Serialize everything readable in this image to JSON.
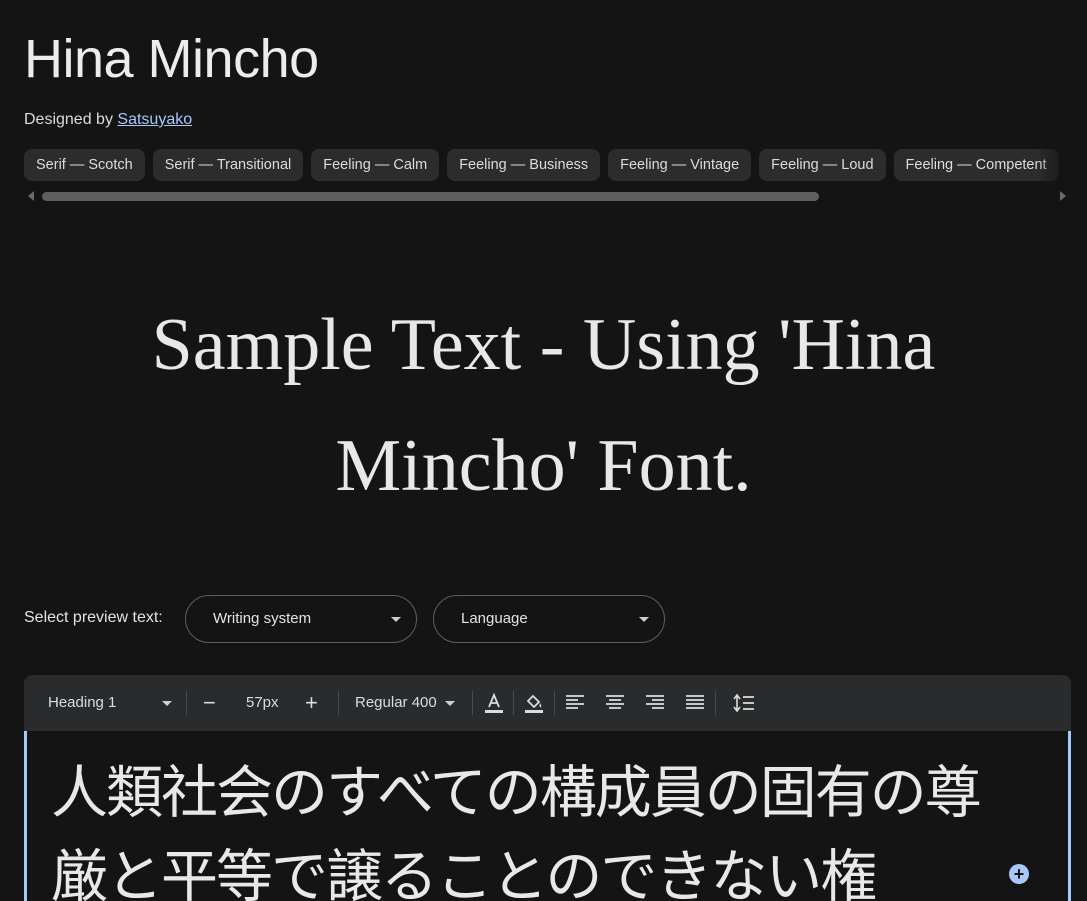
{
  "header": {
    "title": "Hina Mincho",
    "designed_by_prefix": "Designed by",
    "designer_name": "Satsuyako"
  },
  "tags": [
    "Serif — Scotch",
    "Serif — Transitional",
    "Feeling — Calm",
    "Feeling — Business",
    "Feeling — Vintage",
    "Feeling — Loud",
    "Feeling — Competent"
  ],
  "sample_text": "Sample Text - Using 'Hina Mincho' Font.",
  "preview": {
    "label": "Select preview text:",
    "writing_system": "Writing system",
    "language": "Language"
  },
  "toolbar": {
    "style": "Heading 1",
    "decrease": "−",
    "size": "57px",
    "increase": "+",
    "weight": "Regular 400"
  },
  "editor": {
    "text": "人類社会のすべての構成員の固有の尊厳と平等で譲ることのできない権"
  },
  "colors": {
    "background": "#141414",
    "accent": "#a8c7fa",
    "chip": "#2c2c2c",
    "toolbar": "#2a2b2d"
  },
  "icons": [
    "text-color-icon",
    "highlight-icon",
    "align-left-icon",
    "align-center-icon",
    "align-right-icon",
    "align-justify-icon",
    "line-height-icon",
    "add-icon"
  ]
}
